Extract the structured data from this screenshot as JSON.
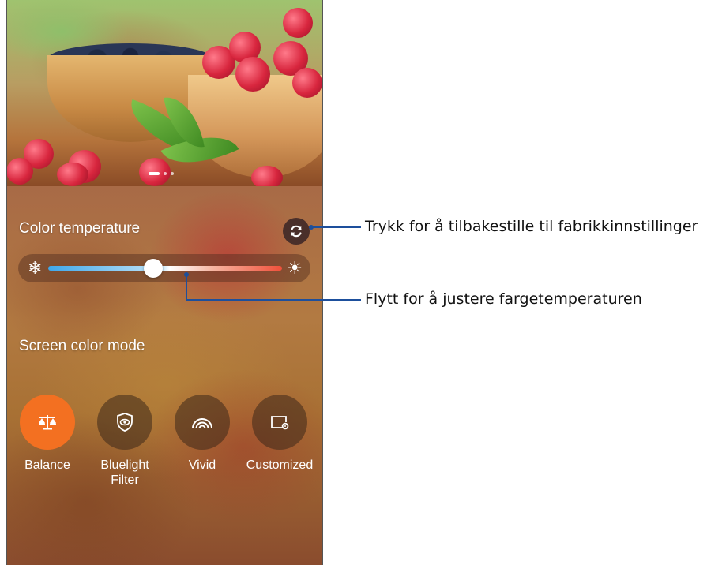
{
  "screen": {
    "color_temperature_label": "Color temperature",
    "screen_color_mode_label": "Screen color mode",
    "slider": {
      "value_fraction": 0.45,
      "min_icon": "snowflake-icon",
      "max_icon": "sun-icon"
    },
    "modes": [
      {
        "label": "Balance",
        "icon": "balance-scale-icon",
        "selected": true
      },
      {
        "label": "Bluelight\nFilter",
        "icon": "eye-shield-icon",
        "selected": false
      },
      {
        "label": "Vivid",
        "icon": "rainbow-icon",
        "selected": false
      },
      {
        "label": "Customized",
        "icon": "custom-screen-icon",
        "selected": false
      }
    ],
    "reset_icon": "refresh-icon",
    "accent_color": "#f37021"
  },
  "annotations": {
    "reset": "Trykk for å tilbakestille til fabrikkinnstillinger",
    "slider": "Flytt for å justere fargetemperaturen",
    "line_color": "#1d4f9c"
  }
}
